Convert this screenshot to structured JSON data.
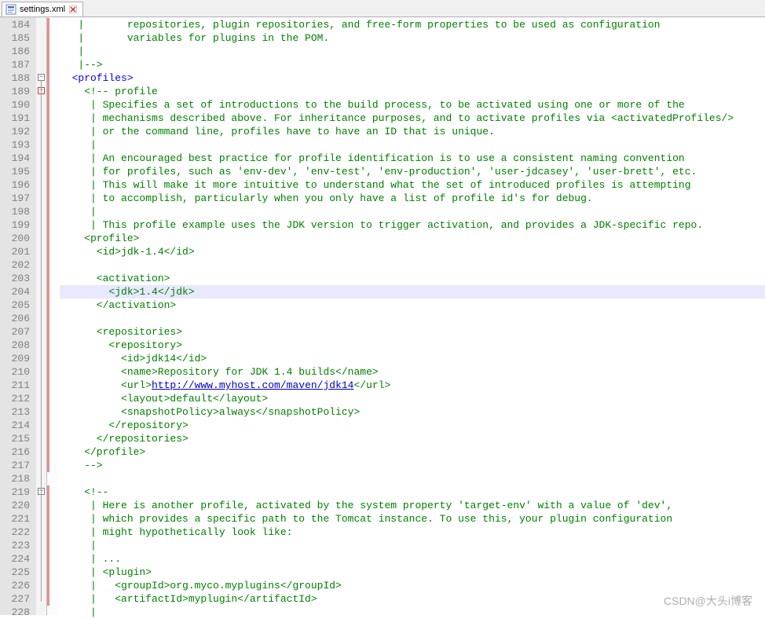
{
  "tab": {
    "filename": "settings.xml"
  },
  "line_start": 184,
  "highlighted_line": 204,
  "fold_markers": [
    {
      "line": 188,
      "type": "minus"
    },
    {
      "line": 189,
      "type": "minus-red"
    },
    {
      "line": 219,
      "type": "minus"
    }
  ],
  "change_bars": [
    {
      "from": 184,
      "to": 217
    },
    {
      "from": 219,
      "to": 227
    }
  ],
  "code_lines": [
    [
      [
        "cmt",
        "   |       repositories, plugin repositories, and free-form properties to be used as configuration"
      ]
    ],
    [
      [
        "cmt",
        "   |       variables for plugins in the POM."
      ]
    ],
    [
      [
        "cmt",
        "   |"
      ]
    ],
    [
      [
        "cmt",
        "   |-->"
      ]
    ],
    [
      [
        "txt",
        "  "
      ],
      [
        "tag",
        "<profiles>"
      ]
    ],
    [
      [
        "txt",
        "    "
      ],
      [
        "cmt",
        "<!-- profile"
      ]
    ],
    [
      [
        "cmt",
        "     | Specifies a set of introductions to the build process, to be activated using one or more of the"
      ]
    ],
    [
      [
        "cmt",
        "     | mechanisms described above. For inheritance purposes, and to activate profiles via <activatedProfiles/>"
      ]
    ],
    [
      [
        "cmt",
        "     | or the command line, profiles have to have an ID that is unique."
      ]
    ],
    [
      [
        "cmt",
        "     |"
      ]
    ],
    [
      [
        "cmt",
        "     | An encouraged best practice for profile identification is to use a consistent naming convention"
      ]
    ],
    [
      [
        "cmt",
        "     | for profiles, such as 'env-dev', 'env-test', 'env-production', 'user-jdcasey', 'user-brett', etc."
      ]
    ],
    [
      [
        "cmt",
        "     | This will make it more intuitive to understand what the set of introduced profiles is attempting"
      ]
    ],
    [
      [
        "cmt",
        "     | to accomplish, particularly when you only have a list of profile id's for debug."
      ]
    ],
    [
      [
        "cmt",
        "     |"
      ]
    ],
    [
      [
        "cmt",
        "     | This profile example uses the JDK version to trigger activation, and provides a JDK-specific repo."
      ]
    ],
    [
      [
        "cmt",
        "    <profile>"
      ]
    ],
    [
      [
        "cmt",
        "      <id>jdk-1.4</id>"
      ]
    ],
    [
      [
        "cmt",
        ""
      ]
    ],
    [
      [
        "cmt",
        "      <activation>"
      ]
    ],
    [
      [
        "cmt",
        "        <jdk>1.4</jdk>"
      ]
    ],
    [
      [
        "cmt",
        "      </activation>"
      ]
    ],
    [
      [
        "cmt",
        ""
      ]
    ],
    [
      [
        "cmt",
        "      <repositories>"
      ]
    ],
    [
      [
        "cmt",
        "        <repository>"
      ]
    ],
    [
      [
        "cmt",
        "          <id>jdk14</id>"
      ]
    ],
    [
      [
        "cmt",
        "          <name>Repository for JDK 1.4 builds</name>"
      ]
    ],
    [
      [
        "cmt",
        "          <url>"
      ],
      [
        "url",
        "http://www.myhost.com/maven/jdk14"
      ],
      [
        "cmt",
        "</url>"
      ]
    ],
    [
      [
        "cmt",
        "          <layout>default</layout>"
      ]
    ],
    [
      [
        "cmt",
        "          <snapshotPolicy>always</snapshotPolicy>"
      ]
    ],
    [
      [
        "cmt",
        "        </repository>"
      ]
    ],
    [
      [
        "cmt",
        "      </repositories>"
      ]
    ],
    [
      [
        "cmt",
        "    </profile>"
      ]
    ],
    [
      [
        "cmt",
        "    -->"
      ]
    ],
    [
      [
        "txt",
        ""
      ]
    ],
    [
      [
        "txt",
        "    "
      ],
      [
        "cmt",
        "<!--"
      ]
    ],
    [
      [
        "cmt",
        "     | Here is another profile, activated by the system property 'target-env' with a value of 'dev',"
      ]
    ],
    [
      [
        "cmt",
        "     | which provides a specific path to the Tomcat instance. To use this, your plugin configuration"
      ]
    ],
    [
      [
        "cmt",
        "     | might hypothetically look like:"
      ]
    ],
    [
      [
        "cmt",
        "     |"
      ]
    ],
    [
      [
        "cmt",
        "     | ..."
      ]
    ],
    [
      [
        "cmt",
        "     | <plugin>"
      ]
    ],
    [
      [
        "cmt",
        "     |   <groupId>org.myco.myplugins</groupId>"
      ]
    ],
    [
      [
        "cmt",
        "     |   <artifactId>myplugin</artifactId>"
      ]
    ],
    [
      [
        "cmt",
        "     |"
      ]
    ]
  ],
  "watermark": "CSDN@大头i博客"
}
